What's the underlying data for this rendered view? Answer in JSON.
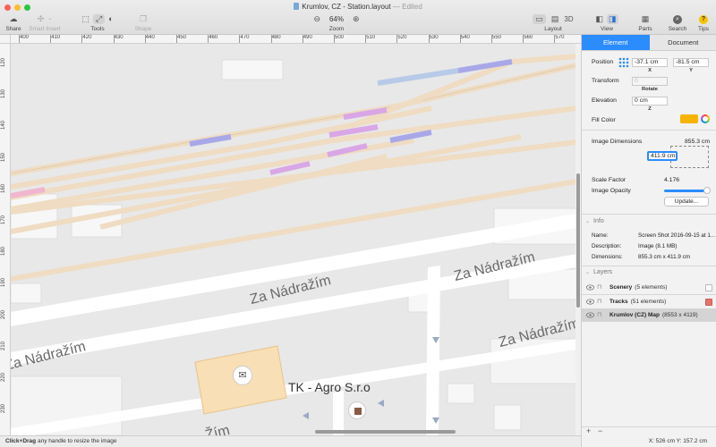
{
  "window": {
    "title": "Krumlov, CZ - Station.layout",
    "title_separator": "—",
    "status": "Edited"
  },
  "toolbar": {
    "share": "Share",
    "smart_insert": "Smart Insert",
    "tools": "Tools",
    "shape": "Shape",
    "zoom_label": "Zoom",
    "zoom_value": "64%",
    "zoom_out": "−",
    "zoom_in": "+",
    "layout": "Layout",
    "layout_3d": "3D",
    "view": "View",
    "parts": "Parts",
    "search": "Search",
    "tips": "Tips",
    "tips_glyph": "?"
  },
  "ruler": {
    "top_ticks": [
      "400",
      "410",
      "420",
      "430",
      "440",
      "450",
      "460",
      "470",
      "480",
      "490",
      "500",
      "510",
      "520",
      "530",
      "540",
      "550",
      "560",
      "570"
    ],
    "left_ticks": [
      "120",
      "130",
      "140",
      "150",
      "160",
      "170",
      "180",
      "190",
      "200",
      "210",
      "220",
      "230"
    ]
  },
  "map": {
    "street_1": "Za Nádražím",
    "street_2": "Za Nádražím",
    "street_3": "Za Nádražím",
    "street_4": "Za Nádražím",
    "street_5": "Žím",
    "poi": "TK - Agro S.r.o"
  },
  "statusbar": {
    "hint_bold": "Click+Drag",
    "hint_rest": " any handle to resize the image"
  },
  "coordinates": "X: 526 cm   Y: 157.2 cm",
  "inspector": {
    "tabs": [
      "Element",
      "Document"
    ],
    "position": {
      "label": "Position",
      "x_value": "-37.1 cm",
      "y_value": "-81.5 cm",
      "x_label": "X",
      "y_label": "Y"
    },
    "transform": {
      "label": "Transform",
      "rotate_value": "0",
      "rotate_label": "Rotate"
    },
    "elevation": {
      "label": "Elevation",
      "value": "0 cm",
      "z_label": "Z"
    },
    "fill_color": {
      "label": "Fill Color",
      "color": "#f5b400"
    },
    "image_dimensions": {
      "label": "Image Dimensions",
      "width": "855.3 cm",
      "height_editing": "411.9 cm"
    },
    "scale_factor": {
      "label": "Scale Factor",
      "value": "4.176"
    },
    "image_opacity": {
      "label": "Image Opacity",
      "value_fraction": 0.95
    },
    "update_button": "Update...",
    "info": {
      "header": "Info",
      "name_label": "Name:",
      "name_value": "Screen Shot 2016-09-15 at 1...",
      "description_label": "Description:",
      "description_value": "Image (8.1 MB)",
      "dimensions_label": "Dimensions:",
      "dimensions_value": "855.3 cm x 411.9 cm"
    },
    "layers": {
      "header": "Layers",
      "items": [
        {
          "name": "Scenery",
          "count": "(5 elements)",
          "chip": "#ffffff"
        },
        {
          "name": "Tracks",
          "count": "(51 elements)",
          "chip": "#e8736b"
        },
        {
          "name": "Krumlov (CZ) Map",
          "count": "(8553 x 4119)",
          "chip": ""
        }
      ]
    },
    "bottom_add": "+",
    "bottom_remove": "−"
  }
}
